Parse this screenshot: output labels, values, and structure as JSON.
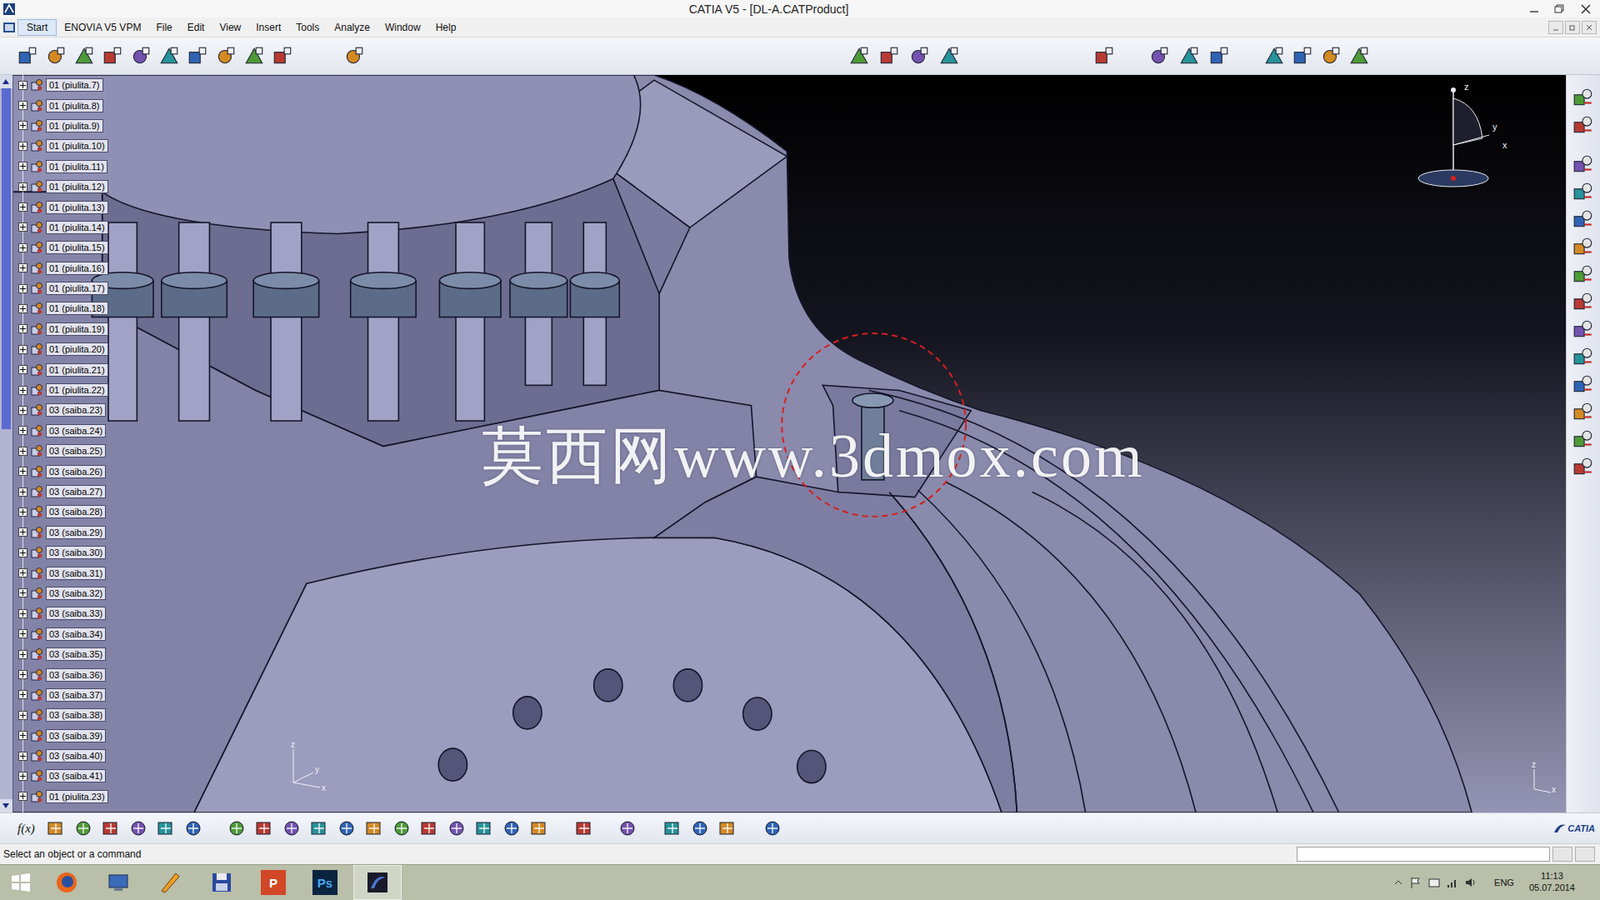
{
  "window": {
    "title": "CATIA V5 - [DL-A.CATProduct]"
  },
  "menu": [
    "Start",
    "ENOVIA V5 VPM",
    "File",
    "Edit",
    "View",
    "Insert",
    "Tools",
    "Analyze",
    "Window",
    "Help"
  ],
  "tree": {
    "scroll_level": 0.48,
    "items": [
      {
        "label": "01 (piulita.7)",
        "expanded": false
      },
      {
        "label": "01 (piulita.8)",
        "expanded": false
      },
      {
        "label": "01 (piulita.9)",
        "expanded": false
      },
      {
        "label": "01 (piulita.10)",
        "expanded": false
      },
      {
        "label": "01 (piulita.11)",
        "expanded": false
      },
      {
        "label": "01 (piulita.12)",
        "expanded": false
      },
      {
        "label": "01 (piulita.13)",
        "expanded": false
      },
      {
        "label": "01 (piulita.14)",
        "expanded": false
      },
      {
        "label": "01 (piulita.15)",
        "expanded": false
      },
      {
        "label": "01 (piulita.16)",
        "expanded": false
      },
      {
        "label": "01 (piulita.17)",
        "expanded": false
      },
      {
        "label": "01 (piulita.18)",
        "expanded": false
      },
      {
        "label": "01 (piulita.19)",
        "expanded": false
      },
      {
        "label": "01 (piulita.20)",
        "expanded": false
      },
      {
        "label": "01 (piulita.21)",
        "expanded": false
      },
      {
        "label": "01 (piulita.22)",
        "expanded": false
      },
      {
        "label": "03 (saiba.23)",
        "expanded": false
      },
      {
        "label": "03 (saiba.24)",
        "expanded": false
      },
      {
        "label": "03 (saiba.25)",
        "expanded": false
      },
      {
        "label": "03 (saiba.26)",
        "expanded": false
      },
      {
        "label": "03 (saiba.27)",
        "expanded": false
      },
      {
        "label": "03 (saiba.28)",
        "expanded": false
      },
      {
        "label": "03 (saiba.29)",
        "expanded": false
      },
      {
        "label": "03 (saiba.30)",
        "expanded": false
      },
      {
        "label": "03 (saiba.31)",
        "expanded": false
      },
      {
        "label": "03 (saiba.32)",
        "expanded": false
      },
      {
        "label": "03 (saiba.33)",
        "expanded": false
      },
      {
        "label": "03 (saiba.34)",
        "expanded": false
      },
      {
        "label": "03 (saiba.35)",
        "expanded": false
      },
      {
        "label": "03 (saiba.36)",
        "expanded": false
      },
      {
        "label": "03 (saiba.37)",
        "expanded": false
      },
      {
        "label": "03 (saiba.38)",
        "expanded": false
      },
      {
        "label": "03 (saiba.39)",
        "expanded": false
      },
      {
        "label": "03 (saiba.40)",
        "expanded": false
      },
      {
        "label": "03 (saiba.41)",
        "expanded": false
      },
      {
        "label": "01 (piulita.23)",
        "expanded": false
      }
    ]
  },
  "viewport": {
    "watermark": "莫西网www.3dmox.com",
    "compass_axes": [
      "z",
      "y",
      "x"
    ],
    "axis_labels": [
      "z",
      "y",
      "x"
    ],
    "corner_axis_labels": [
      "z",
      "x"
    ]
  },
  "bottom_toolbar": {
    "formula": "f(x)"
  },
  "logo": "CATIA",
  "status_bar": {
    "prompt": "Select an object or a command",
    "input": ""
  },
  "taskbar": {
    "apps": [
      {
        "kind": "firefox",
        "selected": false
      },
      {
        "kind": "explorer",
        "selected": false
      },
      {
        "kind": "tool",
        "selected": false
      },
      {
        "kind": "save",
        "selected": false
      },
      {
        "kind": "powerpoint",
        "label": "P",
        "selected": false
      },
      {
        "kind": "photoshop",
        "label": "Ps",
        "selected": false
      },
      {
        "kind": "catia",
        "selected": true
      }
    ],
    "language": "ENG",
    "time": "11:13",
    "date": "05.07.2014"
  }
}
